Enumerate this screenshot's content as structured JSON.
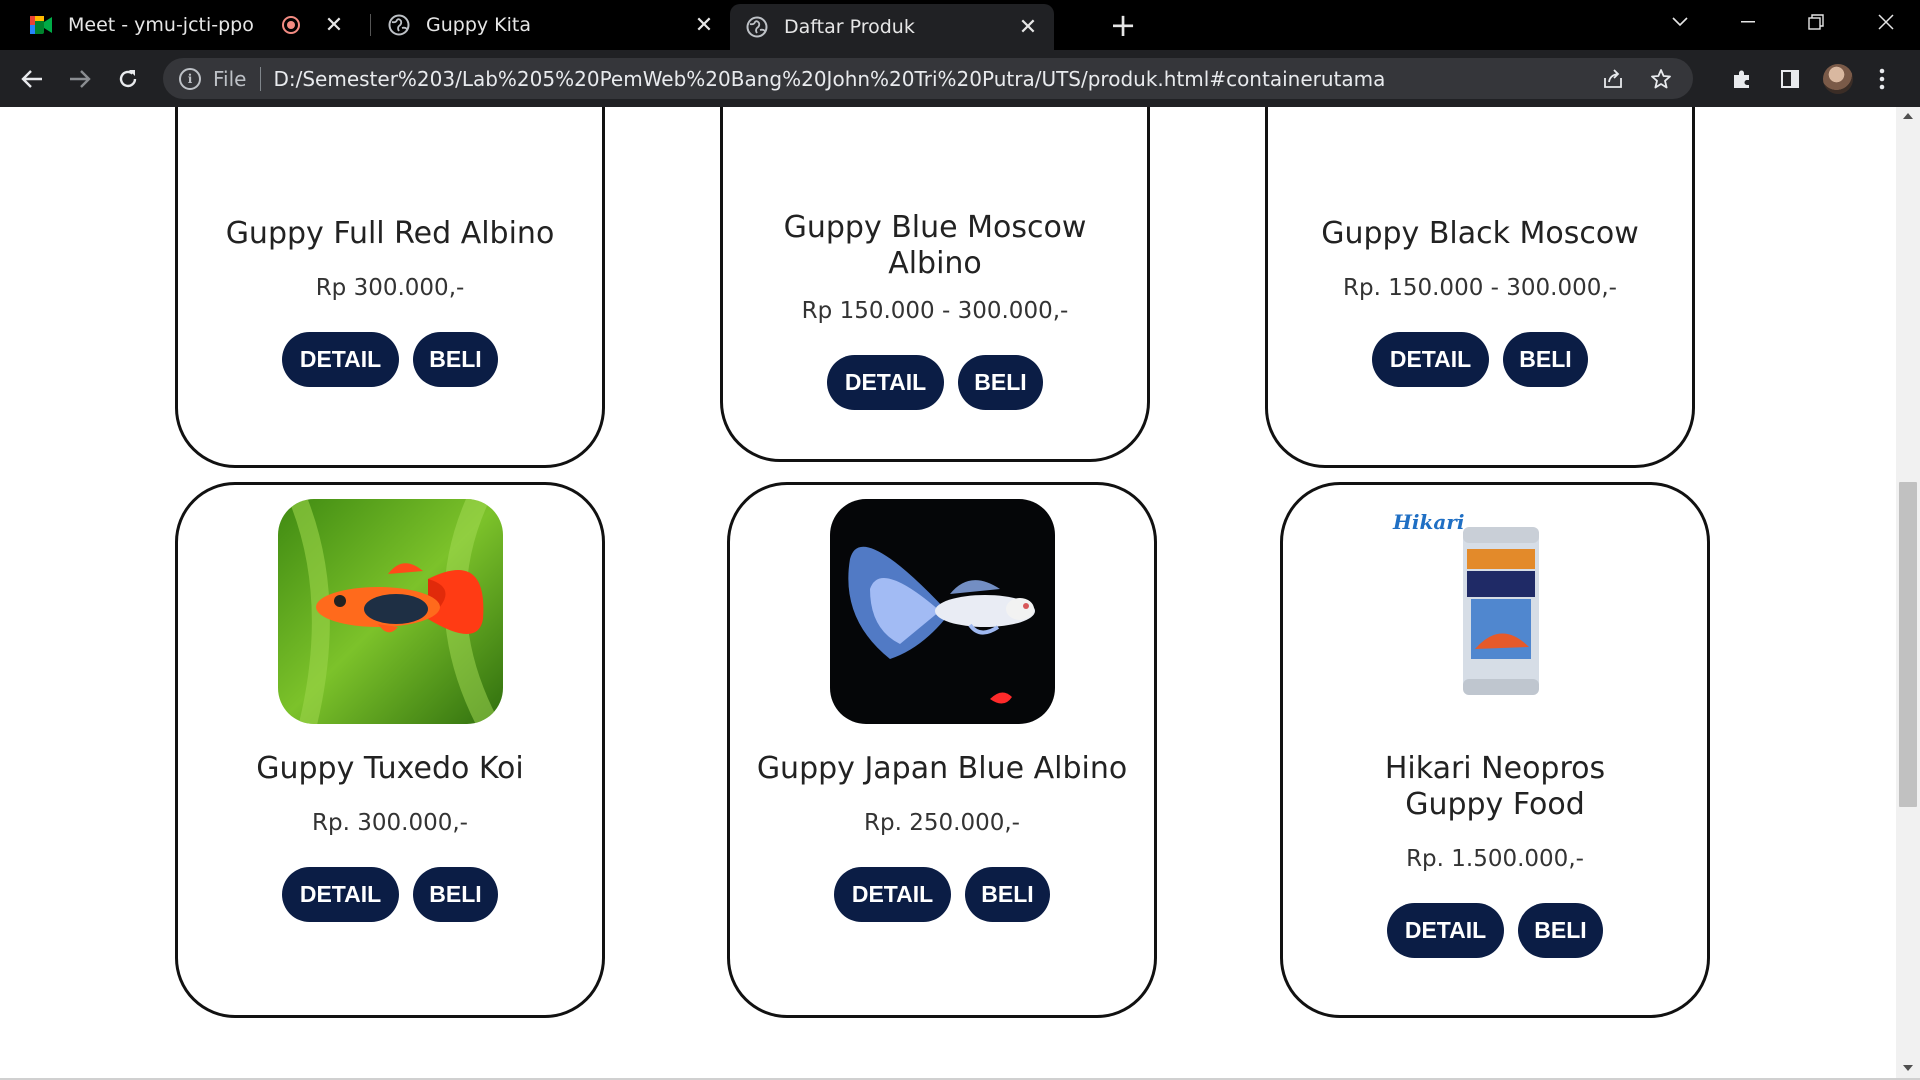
{
  "browser": {
    "tabs": [
      {
        "title": "Meet - ymu-jcti-ppo",
        "icon": "google-meet-icon",
        "recording": true
      },
      {
        "title": "Guppy Kita",
        "icon": "globe-icon"
      },
      {
        "title": "Daftar Produk",
        "icon": "globe-icon",
        "active": true
      }
    ],
    "address": {
      "scheme": "File",
      "url": "D:/Semester%203/Lab%205%20PemWeb%20Bang%20John%20Tri%20Putra/UTS/produk.html#containerutama"
    }
  },
  "page": {
    "buttons": {
      "detail": "DETAIL",
      "beli": "BELI"
    },
    "products_row1": [
      {
        "name": "Guppy Full Red Albino",
        "price": "Rp 300.000,-"
      },
      {
        "name": "Guppy Blue Moscow Albino",
        "price": "Rp 150.000 - 300.000,-"
      },
      {
        "name": "Guppy Black Moscow",
        "price": "Rp. 150.000 - 300.000,-"
      }
    ],
    "products_row2": [
      {
        "name": "Guppy Tuxedo Koi",
        "price": "Rp. 300.000,-",
        "image": "guppy-tuxedo-koi-image"
      },
      {
        "name": "Guppy Japan Blue Albino",
        "price": "Rp. 250.000,-",
        "image": "guppy-japan-blue-albino-image"
      },
      {
        "name": "Hikari Neopros Guppy Food",
        "price": "Rp. 1.500.000,-",
        "image": "hikari-neopros-can-image",
        "brand_logo": "Hikari"
      }
    ]
  },
  "colors": {
    "button_bg": "#0b1d45",
    "card_border": "#111111",
    "chrome_dark": "#202124"
  }
}
